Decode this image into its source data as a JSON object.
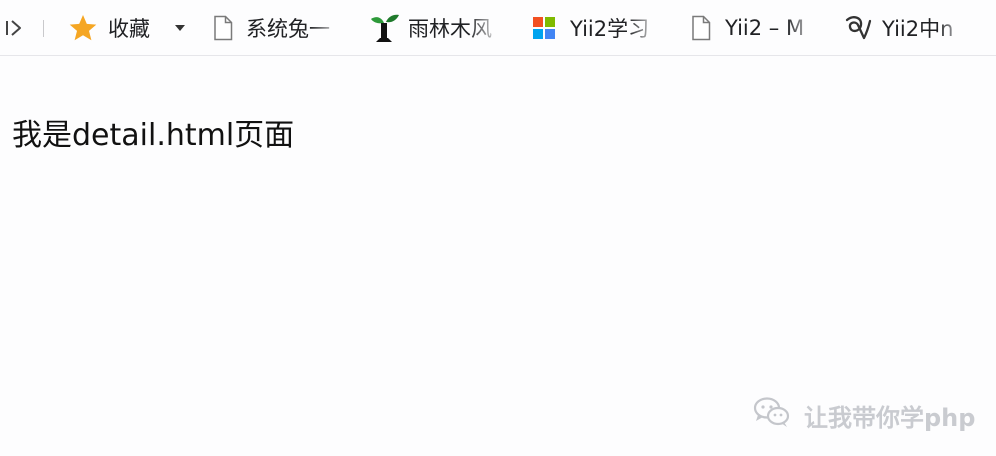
{
  "bookmarks_bar": {
    "expand_icon": "panel-expand-icon",
    "items": [
      {
        "label": "收藏",
        "icon": "star-icon",
        "icon_color": "#f5a623"
      },
      {
        "label": "系统兔一",
        "icon": "page-icon"
      },
      {
        "label": "雨林木风",
        "icon": "tree-logo-icon"
      },
      {
        "label": "Yii2学习",
        "icon": "tiles-logo-icon",
        "icon_colors": [
          "#f25022",
          "#7fba00",
          "#00a4ef",
          "#4285f4"
        ]
      },
      {
        "label": "Yii2 – M",
        "icon": "page-icon"
      },
      {
        "label": "Yii2中n",
        "icon": "swirl-logo-icon"
      }
    ],
    "favorites_dropdown_icon": "caret-down-icon"
  },
  "page": {
    "content_text": "我是detail.html页面"
  },
  "watermark": {
    "icon": "wechat-icon",
    "text": "让我带你学php"
  }
}
